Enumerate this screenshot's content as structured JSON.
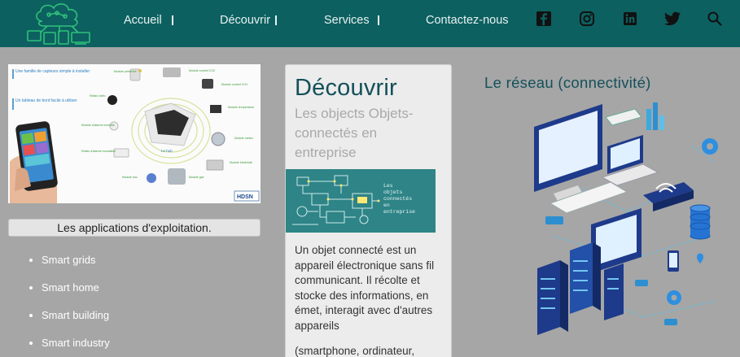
{
  "nav": {
    "items": [
      {
        "label": "Accueil"
      },
      {
        "label": "Découvrir"
      },
      {
        "label": "Services"
      },
      {
        "label": "Contactez-nous"
      }
    ],
    "social_icons": [
      "facebook-icon",
      "instagram-icon",
      "linkedin-icon",
      "twitter-icon"
    ],
    "search_icon": "search-icon"
  },
  "hero": {
    "left_labels": [
      "Une famille de capteurs simple à installer",
      "Un tableau de bord facile à utiliser"
    ],
    "module_labels": [
      "Module présence",
      "Module confort CO2",
      "Relais vidéo",
      "Module confort COV",
      "Module d'alarme incendie",
      "Module température",
      "Relais d'alarme inondation",
      "Module météo",
      "Module électricité",
      "Module eau",
      "Module gaz"
    ],
    "hub_label": "Le hub",
    "brand": "HDSN"
  },
  "apps": {
    "title": "Les applications d'exploitation.",
    "items": [
      "Smart grids",
      "Smart home",
      "Smart building",
      "Smart industry"
    ]
  },
  "card": {
    "title": "Découvrir",
    "subtitle": "Les objects Objets-connectés en entreprise",
    "image_caption": "Les objets connectés en entreprise",
    "paragraph": "Un objet connecté est un appareil électronique sans fil communicant. Il récolte et stocke des informations, en émet, interagit avec d'autres appareils",
    "paragraph2": "(smartphone, ordinateur,"
  },
  "network": {
    "title": "Le réseau (connectivité)"
  },
  "colors": {
    "header": "#0d6060",
    "background": "#a6a6a6",
    "title": "#14505a",
    "accent": "#1fa3b8"
  }
}
